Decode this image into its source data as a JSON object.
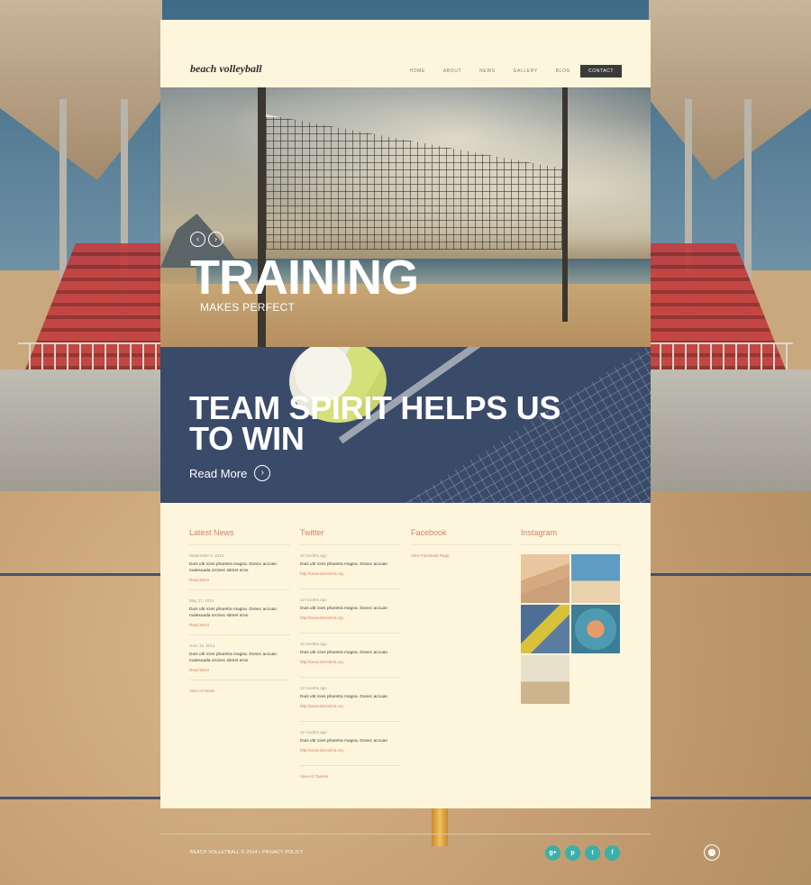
{
  "header": {
    "logo": "beach volleyball",
    "nav": [
      "HOME",
      "ABOUT",
      "NEWS",
      "GALLERY",
      "BLOG"
    ],
    "contact": "CONTACT"
  },
  "slider": {
    "title": "TRAINING",
    "subtitle": "MAKES PERFECT",
    "prev_icon": "‹",
    "next_icon": "›"
  },
  "promo": {
    "title": "TEAM SPIRIT HELPS US TO WIN",
    "read_more": "Read More",
    "arrow_icon": "›"
  },
  "latest_news": {
    "heading": "Latest News",
    "items": [
      {
        "date": "September 6, 2014",
        "text": "Duis ultr icies pharetra magna. Donec accuan malesuada orcinec sitmet eros.",
        "link": "Read More"
      },
      {
        "date": "May 17, 2014",
        "text": "Duis ultr icies pharetra magna. Donec accuan malesuada orcinec sitmet eros.",
        "link": "Read More"
      },
      {
        "date": "June 10, 2014",
        "text": "Duis ultr icies pharetra magna. Donec accuan malesuada orcinec sitmet eros.",
        "link": "Read More"
      }
    ],
    "view_all": "View All News"
  },
  "twitter": {
    "heading": "Twitter",
    "items": [
      {
        "time": "12 months ago",
        "text": "Duis ultr icies pharetra magna. Donec accuan",
        "link": "http://www.demolink.org"
      },
      {
        "time": "12 months ago",
        "text": "Duis ultr icies pharetra magna. Donec accuan",
        "link": "http://www.demolink.org"
      },
      {
        "time": "12 months ago",
        "text": "Duis ultr icies pharetra magna. Donec accuan",
        "link": "http://www.demolink.org"
      },
      {
        "time": "12 months ago",
        "text": "Duis ultr icies pharetra magna. Donec accuan",
        "link": "http://www.demolink.org"
      },
      {
        "time": "12 months ago",
        "text": "Duis ultr icies pharetra magna. Donec accuan",
        "link": "http://www.demolink.org"
      }
    ],
    "view_all": "View All Tweets"
  },
  "facebook": {
    "heading": "Facebook",
    "link": "View Facebook Page"
  },
  "instagram": {
    "heading": "Instagram",
    "photos": [
      "photo-1",
      "photo-2",
      "photo-3",
      "photo-4",
      "photo-5"
    ]
  },
  "footer": {
    "copyright": "BEACH VOLLEYBALL © 2014 • PRIVACY POLICY",
    "social": [
      {
        "icon": "google-plus-icon",
        "glyph": "g+"
      },
      {
        "icon": "pinterest-icon",
        "glyph": "p"
      },
      {
        "icon": "twitter-icon",
        "glyph": "t"
      },
      {
        "icon": "facebook-icon",
        "glyph": "f"
      }
    ],
    "to_top_icon": "↑"
  },
  "colors": {
    "accent": "#d2826b",
    "card_bg": "#fdf5dc",
    "promo_bg": "#3a4a69",
    "social": "#3ab0a8"
  }
}
